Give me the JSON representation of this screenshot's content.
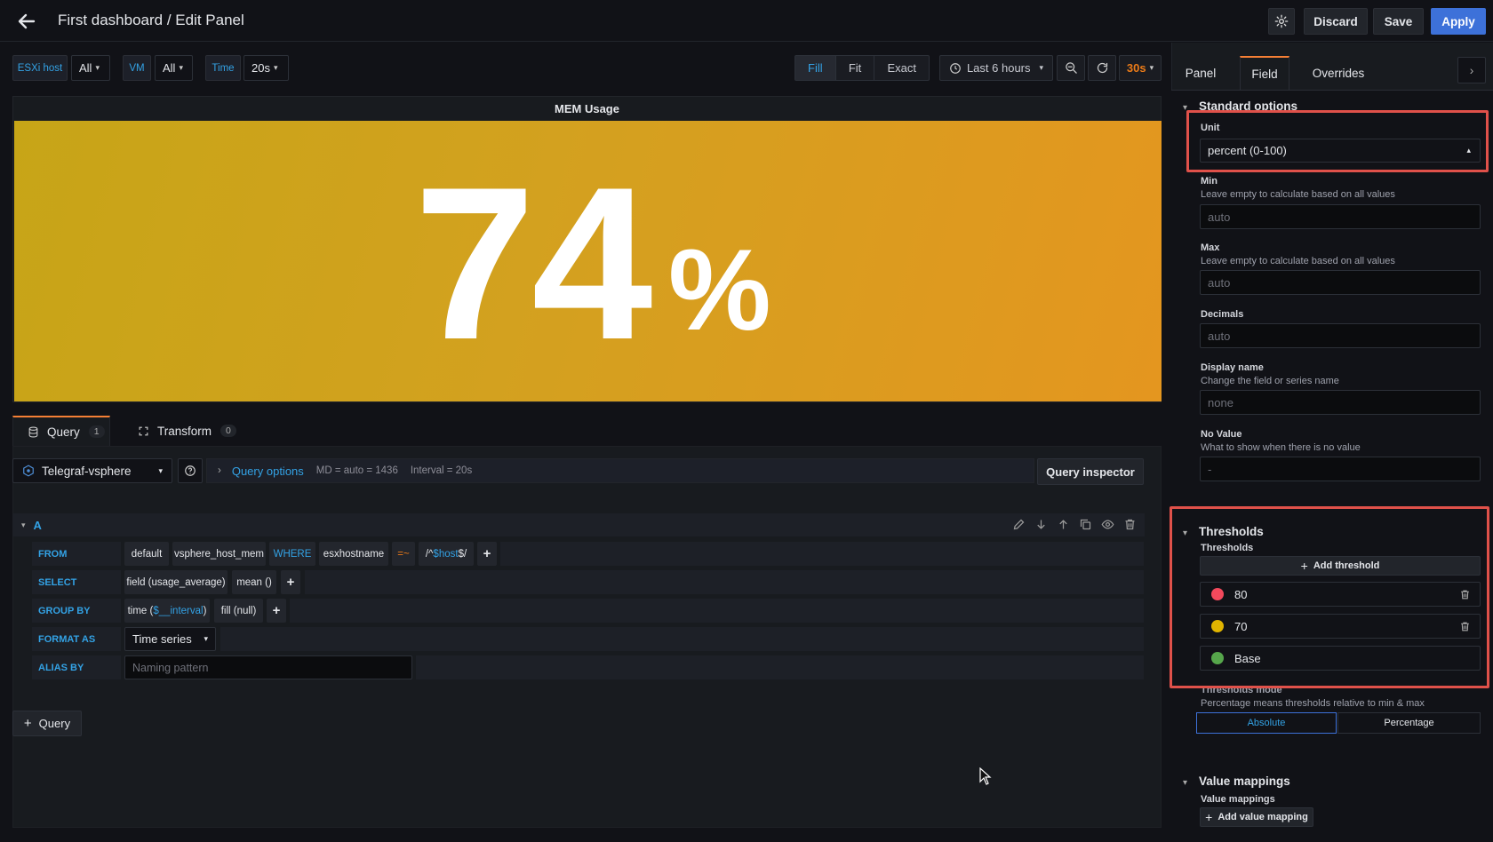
{
  "header": {
    "title": "First dashboard / Edit Panel",
    "discard": "Discard",
    "save": "Save",
    "apply": "Apply"
  },
  "variables": [
    {
      "label": "ESXi host",
      "value": "All"
    },
    {
      "label": "VM",
      "value": "All"
    },
    {
      "label": "Time",
      "value": "20s"
    }
  ],
  "view_modes": {
    "fill": "Fill",
    "fit": "Fit",
    "exact": "Exact"
  },
  "time_range": "Last 6 hours",
  "refresh_interval": "30s",
  "panel": {
    "title": "MEM Usage",
    "value": "74",
    "unit": "%"
  },
  "query_tabs": {
    "query": "Query",
    "query_count": "1",
    "transform": "Transform",
    "transform_count": "0"
  },
  "datasource": "Telegraf-vsphere",
  "query_options": {
    "label": "Query options",
    "md": "MD = auto = 1436",
    "interval": "Interval = 20s",
    "inspector": "Query inspector"
  },
  "query": {
    "ref": "A",
    "from_label": "FROM",
    "policy": "default",
    "measurement": "vsphere_host_mem",
    "where_label": "WHERE",
    "tag": "esxhostname",
    "operator": "=~",
    "regex_prefix": "/^",
    "regex_var": "$host",
    "regex_suffix": "$/",
    "select_label": "SELECT",
    "field": "field (usage_average)",
    "agg": "mean ()",
    "groupby_label": "GROUP BY",
    "time_prefix": "time (",
    "time_var": "$__interval",
    "time_suffix": ")",
    "fill": "fill (null)",
    "format_label": "FORMAT AS",
    "format_value": "Time series",
    "alias_label": "ALIAS BY",
    "alias_placeholder": "Naming pattern",
    "plus": "+"
  },
  "add_query": "Query",
  "sidebar": {
    "tabs": {
      "panel": "Panel",
      "field": "Field",
      "overrides": "Overrides"
    },
    "standard_options": "Standard options",
    "unit_label": "Unit",
    "unit_value": "percent (0-100)",
    "min_label": "Min",
    "min_desc": "Leave empty to calculate based on all values",
    "min_placeholder": "auto",
    "max_label": "Max",
    "max_desc": "Leave empty to calculate based on all values",
    "max_placeholder": "auto",
    "decimals_label": "Decimals",
    "decimals_placeholder": "auto",
    "display_name_label": "Display name",
    "display_name_desc": "Change the field or series name",
    "display_name_placeholder": "none",
    "no_value_label": "No Value",
    "no_value_desc": "What to show when there is no value",
    "no_value_placeholder": "-",
    "thresholds_section": "Thresholds",
    "thresholds_label": "Thresholds",
    "add_threshold": "Add threshold",
    "thresholds": [
      {
        "value": "80",
        "color": "#f2495c"
      },
      {
        "value": "70",
        "color": "#e0b400"
      },
      {
        "value": "Base",
        "color": "#56a64b"
      }
    ],
    "thresholds_mode_label": "Thresholds mode",
    "thresholds_mode_desc": "Percentage means thresholds relative to min & max",
    "mode_absolute": "Absolute",
    "mode_percentage": "Percentage",
    "value_mappings_section": "Value mappings",
    "value_mappings_label": "Value mappings",
    "add_value_mapping": "Add value mapping"
  }
}
